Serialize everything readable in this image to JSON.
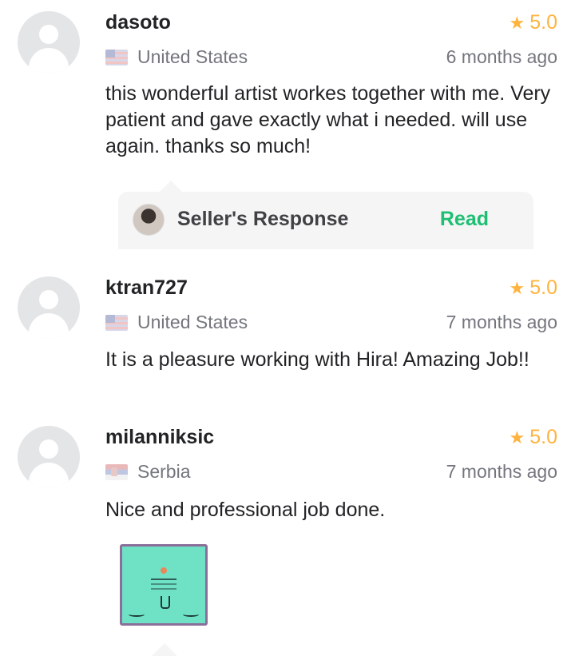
{
  "reviews": [
    {
      "username": "dasoto",
      "rating": "5.0",
      "country": "United States",
      "flag": "us-flag-icon",
      "time": "6 months ago",
      "text": "this wonderful artist workes together with me. Very patient and gave exactly what i needed. will use again. thanks so much!",
      "seller_response": {
        "label": "Seller's Response",
        "action": "Read"
      }
    },
    {
      "username": "ktran727",
      "rating": "5.0",
      "country": "United States",
      "flag": "us-flag-icon",
      "time": "7 months ago",
      "text": "It is a pleasure working with Hira! Amazing Job!!"
    },
    {
      "username": "milanniksic",
      "rating": "5.0",
      "country": "Serbia",
      "flag": "serbia-flag-icon",
      "time": "7 months ago",
      "text": "Nice and professional job done."
    }
  ],
  "colors": {
    "star": "#ffb33e",
    "read_action": "#1dbf73",
    "text_primary": "#222325",
    "text_secondary": "#74767e",
    "response_bg": "#f5f5f5"
  }
}
